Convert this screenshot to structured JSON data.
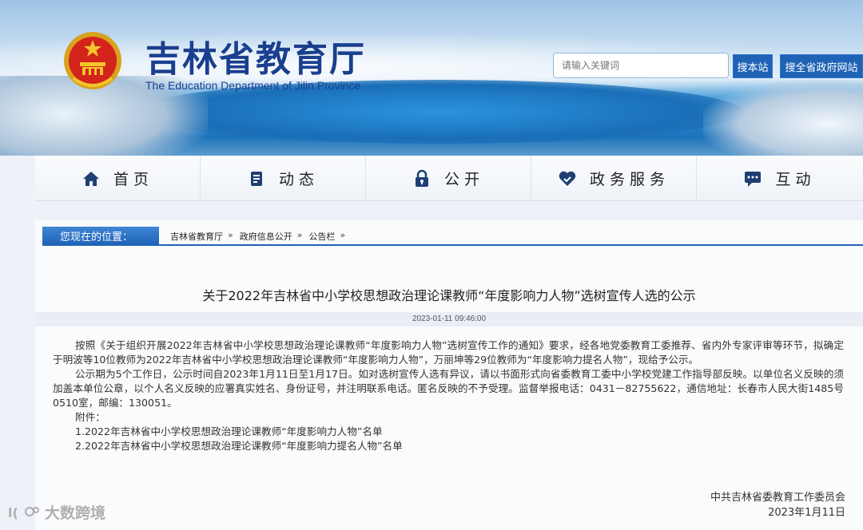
{
  "header": {
    "title": "吉林省教育厅",
    "subtitle": "The Education Department of Jilin Province",
    "search_placeholder": "请输入关键词",
    "search_site_label": "搜本站",
    "search_gov_label": "搜全省政府网站"
  },
  "nav": {
    "items": [
      {
        "label": "首页",
        "icon": "home-icon"
      },
      {
        "label": "动态",
        "icon": "document-icon"
      },
      {
        "label": "公开",
        "icon": "lock-icon"
      },
      {
        "label": "政务服务",
        "icon": "handshake-heart-icon"
      },
      {
        "label": "互动",
        "icon": "chat-icon"
      }
    ]
  },
  "breadcrumb": {
    "tag": "您现在的位置：",
    "items": [
      "吉林省教育厅",
      "政府信息公开",
      "公告栏"
    ]
  },
  "article": {
    "title": "关于2022年吉林省中小学校思想政治理论课教师“年度影响力人物”选树宣传人选的公示",
    "datetime": "2023-01-11 09:46:00",
    "paragraphs": [
      "按照《关于组织开展2022年吉林省中小学校思想政治理论课教师“年度影响力人物”选树宣传工作的通知》要求，经各地党委教育工委推荐、省内外专家评审等环节，拟确定于明波等10位教师为2022年吉林省中小学校思想政治理论课教师“年度影响力人物”，万丽坤等29位教师为“年度影响力提名人物”，现给予公示。",
      "公示期为5个工作日，公示时间自2023年1月11日至1月17日。如对选树宣传人选有异议，请以书面形式向省委教育工委中小学校党建工作指导部反映。以单位名义反映的须加盖本单位公章，以个人名义反映的应署真实姓名、身份证号，并注明联系电话。匿名反映的不予受理。监督举报电话：0431－82755622，通信地址：长春市人民大街1485号0510室，邮编：130051。"
    ],
    "attachments_label": "附件：",
    "attachments": [
      "1.2022年吉林省中小学校思想政治理论课教师“年度影响力人物”名单",
      "2.2022年吉林省中小学校思想政治理论课教师“年度影响力提名人物”名单"
    ],
    "signature_org": "中共吉林省委教育工作委员会",
    "signature_date": "2023年1月11日"
  },
  "watermark": {
    "text": "大数跨境"
  },
  "colors": {
    "brand_blue": "#1f63b6",
    "title_blue": "#1a3f8f"
  }
}
